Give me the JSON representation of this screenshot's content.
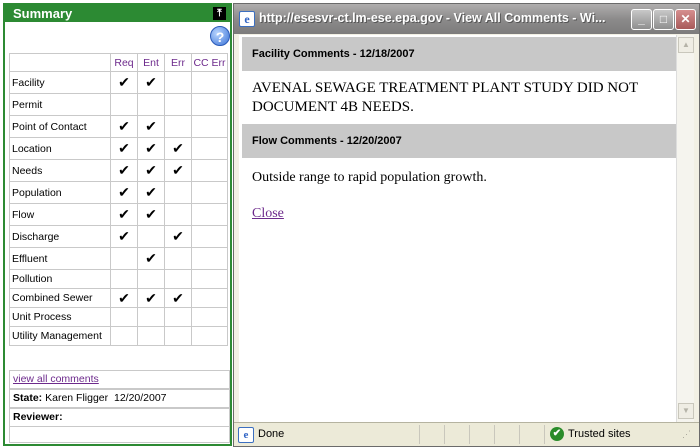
{
  "summary": {
    "title": "Summary",
    "collapse_icon": "⤒",
    "help_icon": "?",
    "columns": [
      "Req",
      "Ent",
      "Err",
      "CC Err"
    ],
    "rows": [
      {
        "label": "Facility",
        "req": "✔",
        "ent": "✔",
        "err": "",
        "cc": ""
      },
      {
        "label": "Permit",
        "req": "",
        "ent": "",
        "err": "",
        "cc": ""
      },
      {
        "label": "Point of Contact",
        "req": "✔",
        "ent": "✔",
        "err": "",
        "cc": ""
      },
      {
        "label": "Location",
        "req": "✔",
        "ent": "✔",
        "err": "✔",
        "cc": ""
      },
      {
        "label": "Needs",
        "req": "✔",
        "ent": "✔",
        "err": "✔",
        "cc": ""
      },
      {
        "label": "Population",
        "req": "✔",
        "ent": "✔",
        "err": "",
        "cc": ""
      },
      {
        "label": "Flow",
        "req": "✔",
        "ent": "✔",
        "err": "",
        "cc": ""
      },
      {
        "label": "Discharge",
        "req": "✔",
        "ent": "",
        "err": "✔",
        "cc": ""
      },
      {
        "label": "Effluent",
        "req": "",
        "ent": "✔",
        "err": "",
        "cc": ""
      },
      {
        "label": "Pollution",
        "req": "",
        "ent": "",
        "err": "",
        "cc": ""
      },
      {
        "label": "Combined Sewer",
        "req": "✔",
        "ent": "✔",
        "err": "✔",
        "cc": ""
      },
      {
        "label": "Unit Process",
        "req": "",
        "ent": "",
        "err": "",
        "cc": ""
      },
      {
        "label": "Utility Management",
        "req": "",
        "ent": "",
        "err": "",
        "cc": ""
      }
    ],
    "view_all_link": "view all comments",
    "state_label": "State:",
    "state_value": "Karen Fligger  12/20/2007",
    "reviewer_label": "Reviewer:"
  },
  "popup": {
    "title": "http://esesvr-ct.lm-ese.epa.gov - View All Comments - Wi...",
    "facility_header": "Facility Comments - 12/18/2007",
    "facility_text": "AVENAL SEWAGE TREATMENT PLANT STUDY DID NOT DOCUMENT 4B NEEDS.",
    "flow_header": "Flow Comments - 12/20/2007",
    "flow_text": "Outside range to rapid population growth.",
    "close_link": "Close",
    "status_done": "Done",
    "status_zone": "Trusted sites"
  }
}
